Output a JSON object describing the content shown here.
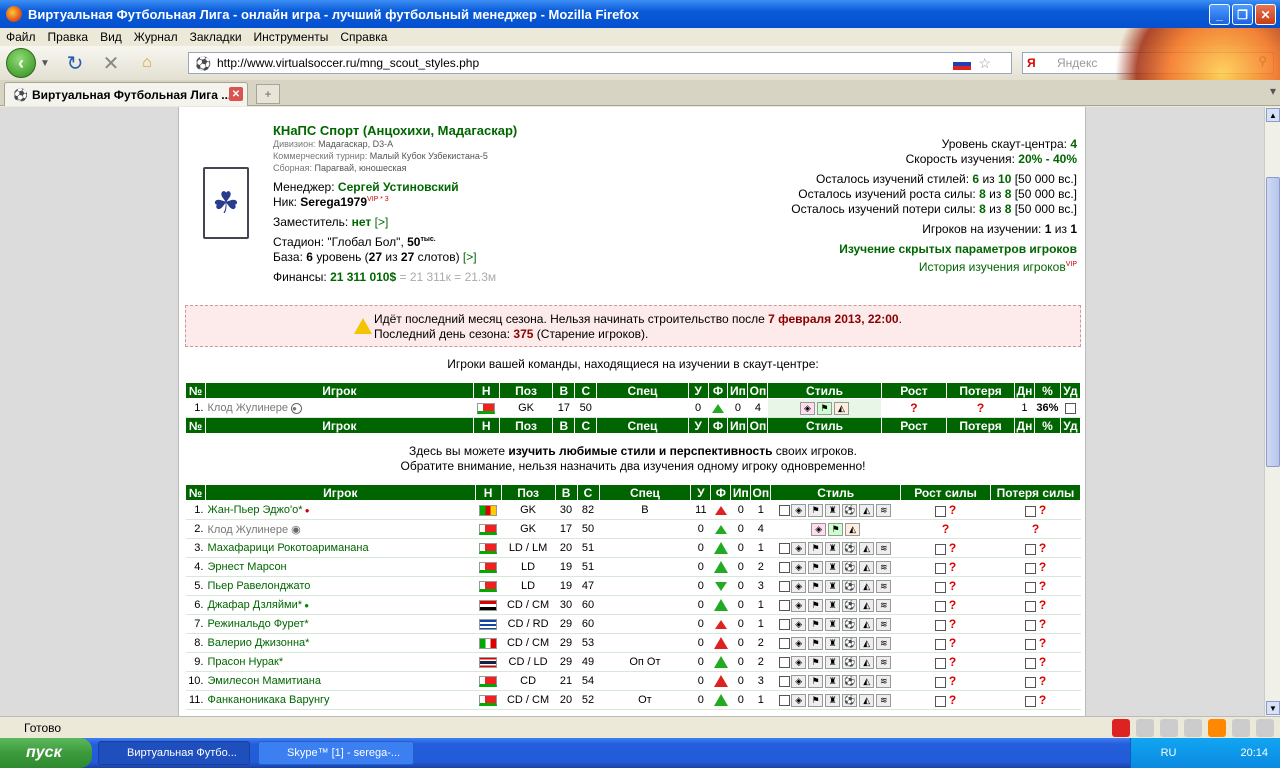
{
  "window": {
    "title": "Виртуальная Футбольная Лига - онлайн игра - лучший футбольный менеджер - Mozilla Firefox"
  },
  "menu": [
    "Файл",
    "Правка",
    "Вид",
    "Журнал",
    "Закладки",
    "Инструменты",
    "Справка"
  ],
  "url": "http://www.virtualsoccer.ru/mng_scout_styles.php",
  "search_placeholder": "Яндекс",
  "search_engine": "Я",
  "tab": {
    "title": "Виртуальная Футбольная Лига ..."
  },
  "club": {
    "name": "КНаПС Спорт (Анцохихи, Мадагаскар)",
    "division_label": "Дивизион:",
    "division": "Мадагаскар, D3-A",
    "cup_label": "Коммерческий турнир:",
    "cup": "Малый Кубок Узбекистана-5",
    "national_label": "Сборная:",
    "national": "Парагвай, юношеская",
    "manager_label": "Менеджер:",
    "manager": "Сергей Устиновский",
    "nick_label": "Ник:",
    "nick": "Serega1979",
    "nick_sup": "VIP * 3",
    "deputy_label": "Заместитель:",
    "deputy": "нет",
    "deputy_link": "[>]",
    "stadium_label": "Стадион:",
    "stadium": "\"Глобал Бол\",",
    "stadium_size": "50",
    "stadium_sup": "тыс.",
    "base_label": "База:",
    "base_level": "6",
    "base_text": "уровень (",
    "base_used": "27",
    "base_of": "из",
    "base_total": "27",
    "base_end": "слотов)",
    "base_link": "[>]",
    "finance_label": "Финансы:",
    "finance": "21 311 010$",
    "finance_extra": "= 21 311к = 21.3м"
  },
  "scout": {
    "level_label": "Уровень скаут-центра:",
    "level": "4",
    "speed_label": "Скорость изучения:",
    "speed": "20% - 40%",
    "styles_label": "Осталось изучений стилей:",
    "styles": "6",
    "styles_of": "из",
    "styles_total": "10",
    "styles_price": "[50 000 вс.]",
    "growth_label": "Осталось изучений роста силы:",
    "growth": "8",
    "growth_of": "из",
    "growth_total": "8",
    "growth_price": "[50 000 вс.]",
    "loss_label": "Осталось изучений потери силы:",
    "loss": "8",
    "loss_of": "из",
    "loss_total": "8",
    "loss_price": "[50 000 вс.]",
    "players_label": "Игроков на изучении:",
    "players": "1",
    "players_of": "из",
    "players_total": "1",
    "hidden_link": "Изучение скрытых параметров игроков",
    "history_link": "История изучения игроков",
    "history_sup": "VIP"
  },
  "alert": {
    "line1a": "Идёт последний месяц сезона. Нельзя начинать строительство после",
    "line1b": "7 февраля 2013, 22:00",
    "line2a": "Последний день сезона:",
    "line2b": "375",
    "line2c": "(Старение игроков)."
  },
  "caption1": "Игроки вашей команды, находящиеся на изучении в скаут-центре:",
  "caption2a": "Здесь вы можете",
  "caption2b": "изучить любимые стили и перспективность",
  "caption2c": "своих игроков.",
  "caption3": "Обратите внимание, нельзя назначить два изучения одному игроку одновременно!",
  "table1_headers": [
    "№",
    "Игрок",
    "Н",
    "Поз",
    "В",
    "С",
    "Спец",
    "У",
    "Ф",
    "Ип",
    "Оп",
    "Стиль",
    "Рост",
    "Потеря",
    "Дн",
    "%",
    "Уд"
  ],
  "table1_row": {
    "n": "1.",
    "name": "Клод Жулинере",
    "pos": "GK",
    "age": "17",
    "str": "50",
    "spec": "",
    "u": "0",
    "ip": "0",
    "op": "4",
    "dn": "1",
    "pct": "36%"
  },
  "table2_headers": [
    "№",
    "Игрок",
    "Н",
    "Поз",
    "В",
    "С",
    "Спец",
    "У",
    "Ф",
    "Ип",
    "Оп",
    "Стиль",
    "Рост силы",
    "Потеря силы"
  ],
  "players": [
    {
      "n": "1.",
      "name": "Жан-Пьер Эджо'о",
      "star": "*",
      "pos": "GK",
      "age": "30",
      "str": "82",
      "spec": "В",
      "u": "11",
      "f": "upr",
      "ip": "0",
      "op": "1",
      "flag": "cm"
    },
    {
      "n": "2.",
      "name": "Клод Жулинере",
      "star": "",
      "pos": "GK",
      "age": "17",
      "str": "50",
      "spec": "",
      "u": "0",
      "f": "up",
      "ip": "0",
      "op": "4",
      "flag": "mg",
      "gray": true
    },
    {
      "n": "3.",
      "name": "Махафарици Рокотоариманана",
      "star": "",
      "pos": "LD / LM",
      "age": "20",
      "str": "51",
      "spec": "",
      "u": "0",
      "f": "upb",
      "ip": "0",
      "op": "1",
      "flag": "mg"
    },
    {
      "n": "4.",
      "name": "Эрнест Марсон",
      "star": "",
      "pos": "LD",
      "age": "19",
      "str": "51",
      "spec": "",
      "u": "0",
      "f": "upb",
      "ip": "0",
      "op": "2",
      "flag": "mg"
    },
    {
      "n": "5.",
      "name": "Пьер Равелонджато",
      "star": "",
      "pos": "LD",
      "age": "19",
      "str": "47",
      "spec": "",
      "u": "0",
      "f": "dn",
      "ip": "0",
      "op": "3",
      "flag": "mg"
    },
    {
      "n": "6.",
      "name": "Джафар Дзляйми",
      "star": "*",
      "pos": "CD / CM",
      "age": "30",
      "str": "60",
      "spec": "",
      "u": "0",
      "f": "upb",
      "ip": "0",
      "op": "1",
      "flag": "eg"
    },
    {
      "n": "7.",
      "name": "Режинальдо Фурет",
      "star": "*",
      "pos": "CD / RD",
      "age": "29",
      "str": "60",
      "spec": "",
      "u": "0",
      "f": "upr",
      "ip": "0",
      "op": "1",
      "flag": "cu"
    },
    {
      "n": "8.",
      "name": "Валерио Джизонна",
      "star": "*",
      "pos": "CD / CM",
      "age": "29",
      "str": "53",
      "spec": "",
      "u": "0",
      "f": "uprb",
      "ip": "0",
      "op": "2",
      "flag": "it"
    },
    {
      "n": "9.",
      "name": "Прасон Нурак",
      "star": "*",
      "pos": "CD / LD",
      "age": "29",
      "str": "49",
      "spec": "Оп От",
      "u": "0",
      "f": "upb",
      "ip": "0",
      "op": "2",
      "flag": "th"
    },
    {
      "n": "10.",
      "name": "Эмилесон Мамитиана",
      "star": "",
      "pos": "CD",
      "age": "21",
      "str": "54",
      "spec": "",
      "u": "0",
      "f": "uprb",
      "ip": "0",
      "op": "3",
      "flag": "mg"
    },
    {
      "n": "11.",
      "name": "Фанканоникака Варунгу",
      "star": "",
      "pos": "CD / CM",
      "age": "20",
      "str": "52",
      "spec": "От",
      "u": "0",
      "f": "upb",
      "ip": "0",
      "op": "1",
      "flag": "mg"
    }
  ],
  "status": {
    "text": "Готово"
  },
  "taskbar": {
    "start": "пуск",
    "task1": "Виртуальная Футбо...",
    "task2": "Skype™ [1] - serega-...",
    "lang": "RU",
    "time": "20:14"
  }
}
